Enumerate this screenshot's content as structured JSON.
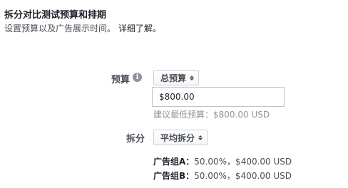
{
  "section": {
    "title": "拆分对比测试预算和排期",
    "subtitle": "设置预算以及广告展示时间。",
    "learn_more": "详细了解。"
  },
  "budget": {
    "label": "预算",
    "info_icon": "info-icon",
    "type_select": "总预算",
    "amount_value": "$800.00",
    "hint": "建议最低预算：$800.00 USD"
  },
  "split": {
    "label": "拆分",
    "mode_select": "平均拆分",
    "groups": [
      {
        "name": "广告组A：",
        "detail": "50.00%，$400.00 USD"
      },
      {
        "name": "广告组B：",
        "detail": "50.00%，$400.00 USD"
      }
    ]
  }
}
